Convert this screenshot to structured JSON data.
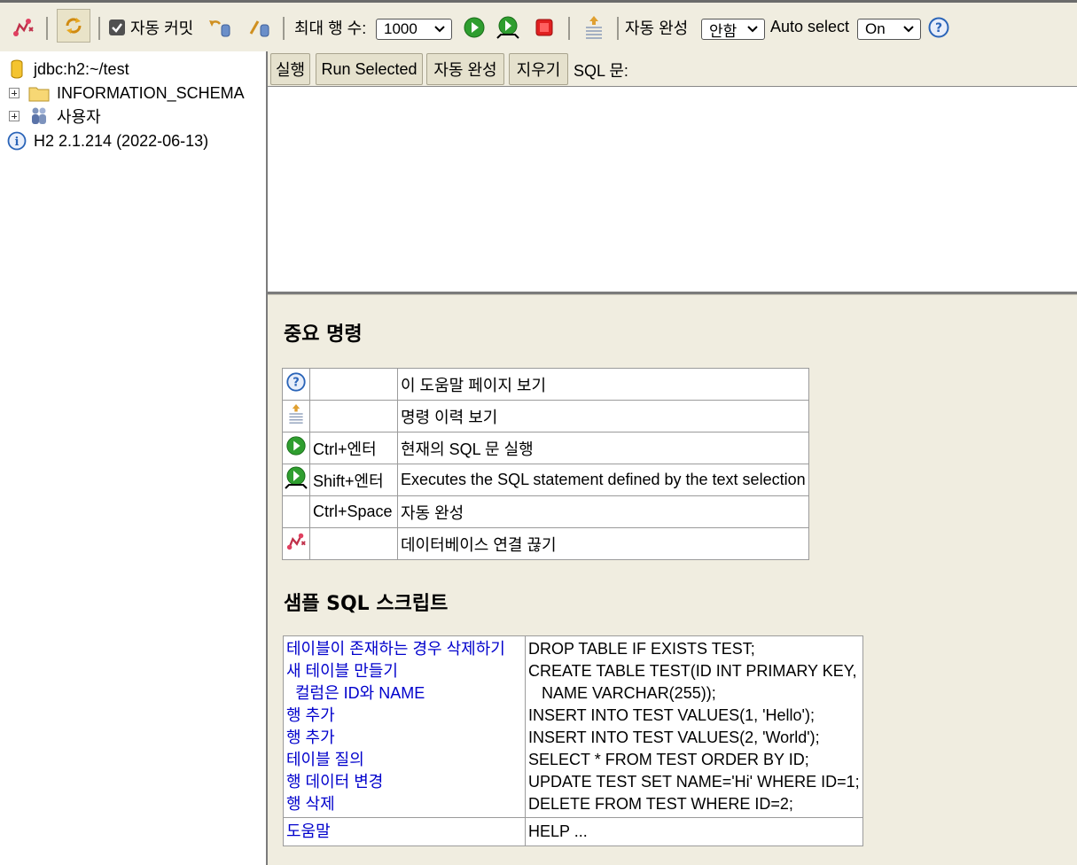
{
  "toolbar": {
    "autocommit_label": "자동 커밋",
    "max_rows_label": "최대 행 수:",
    "max_rows_value": "1000",
    "autocomplete_label": "자동 완성",
    "autocomplete_value": "안함",
    "autoselect_label": "Auto select",
    "autoselect_value": "On",
    "icons": [
      "disconnect-icon",
      "refresh-icon",
      "autocommit-checkbox",
      "rollback-icon",
      "commit-icon",
      "run-icon",
      "run-selected-icon",
      "stop-icon",
      "history-icon",
      "help-icon"
    ],
    "colors": {
      "run_green": "#2f9e2f",
      "stop_red": "#e02020",
      "help_blue": "#2a64b8",
      "bar_bg": "#f0ede0"
    }
  },
  "tree": {
    "connection": "jdbc:h2:~/test",
    "items": [
      {
        "label": "INFORMATION_SCHEMA",
        "icon": "folder-icon"
      },
      {
        "label": "사용자",
        "icon": "users-icon"
      }
    ],
    "version": "H2 2.1.214 (2022-06-13)"
  },
  "query": {
    "buttons": [
      "실행",
      "Run Selected",
      "자동 완성",
      "지우기"
    ],
    "sql_label": "SQL 문:",
    "sql_text": ""
  },
  "help": {
    "important_title": "중요 명령",
    "commands": [
      {
        "icon": "help-icon",
        "key": "",
        "desc": "이 도움말 페이지 보기"
      },
      {
        "icon": "history-icon",
        "key": "",
        "desc": "명령 이력 보기"
      },
      {
        "icon": "run-icon",
        "key": "Ctrl+엔터",
        "desc": "현재의 SQL 문 실행"
      },
      {
        "icon": "run-selected-icon",
        "key": "Shift+엔터",
        "desc": "Executes the SQL statement defined by the text selection"
      },
      {
        "icon": "",
        "key": "Ctrl+Space",
        "desc": "자동 완성"
      },
      {
        "icon": "disconnect-icon",
        "key": "",
        "desc": "데이터베이스 연결 끊기"
      }
    ],
    "sample_title": "샘플 SQL 스크립트",
    "samples_left": [
      "테이블이 존재하는 경우 삭제하기",
      "새 테이블 만들기",
      "  컬럼은 ID와 NAME",
      "행 추가",
      "행 추가",
      "테이블 질의",
      "행 데이터 변경",
      "행 삭제"
    ],
    "samples_right": [
      "DROP TABLE IF EXISTS TEST;",
      "CREATE TABLE TEST(ID INT PRIMARY KEY,",
      "   NAME VARCHAR(255));",
      "INSERT INTO TEST VALUES(1, 'Hello');",
      "INSERT INTO TEST VALUES(2, 'World');",
      "SELECT * FROM TEST ORDER BY ID;",
      "UPDATE TEST SET NAME='Hi' WHERE ID=1;",
      "DELETE FROM TEST WHERE ID=2;"
    ],
    "help_link": "도움말",
    "help_cmd": "HELP ..."
  }
}
